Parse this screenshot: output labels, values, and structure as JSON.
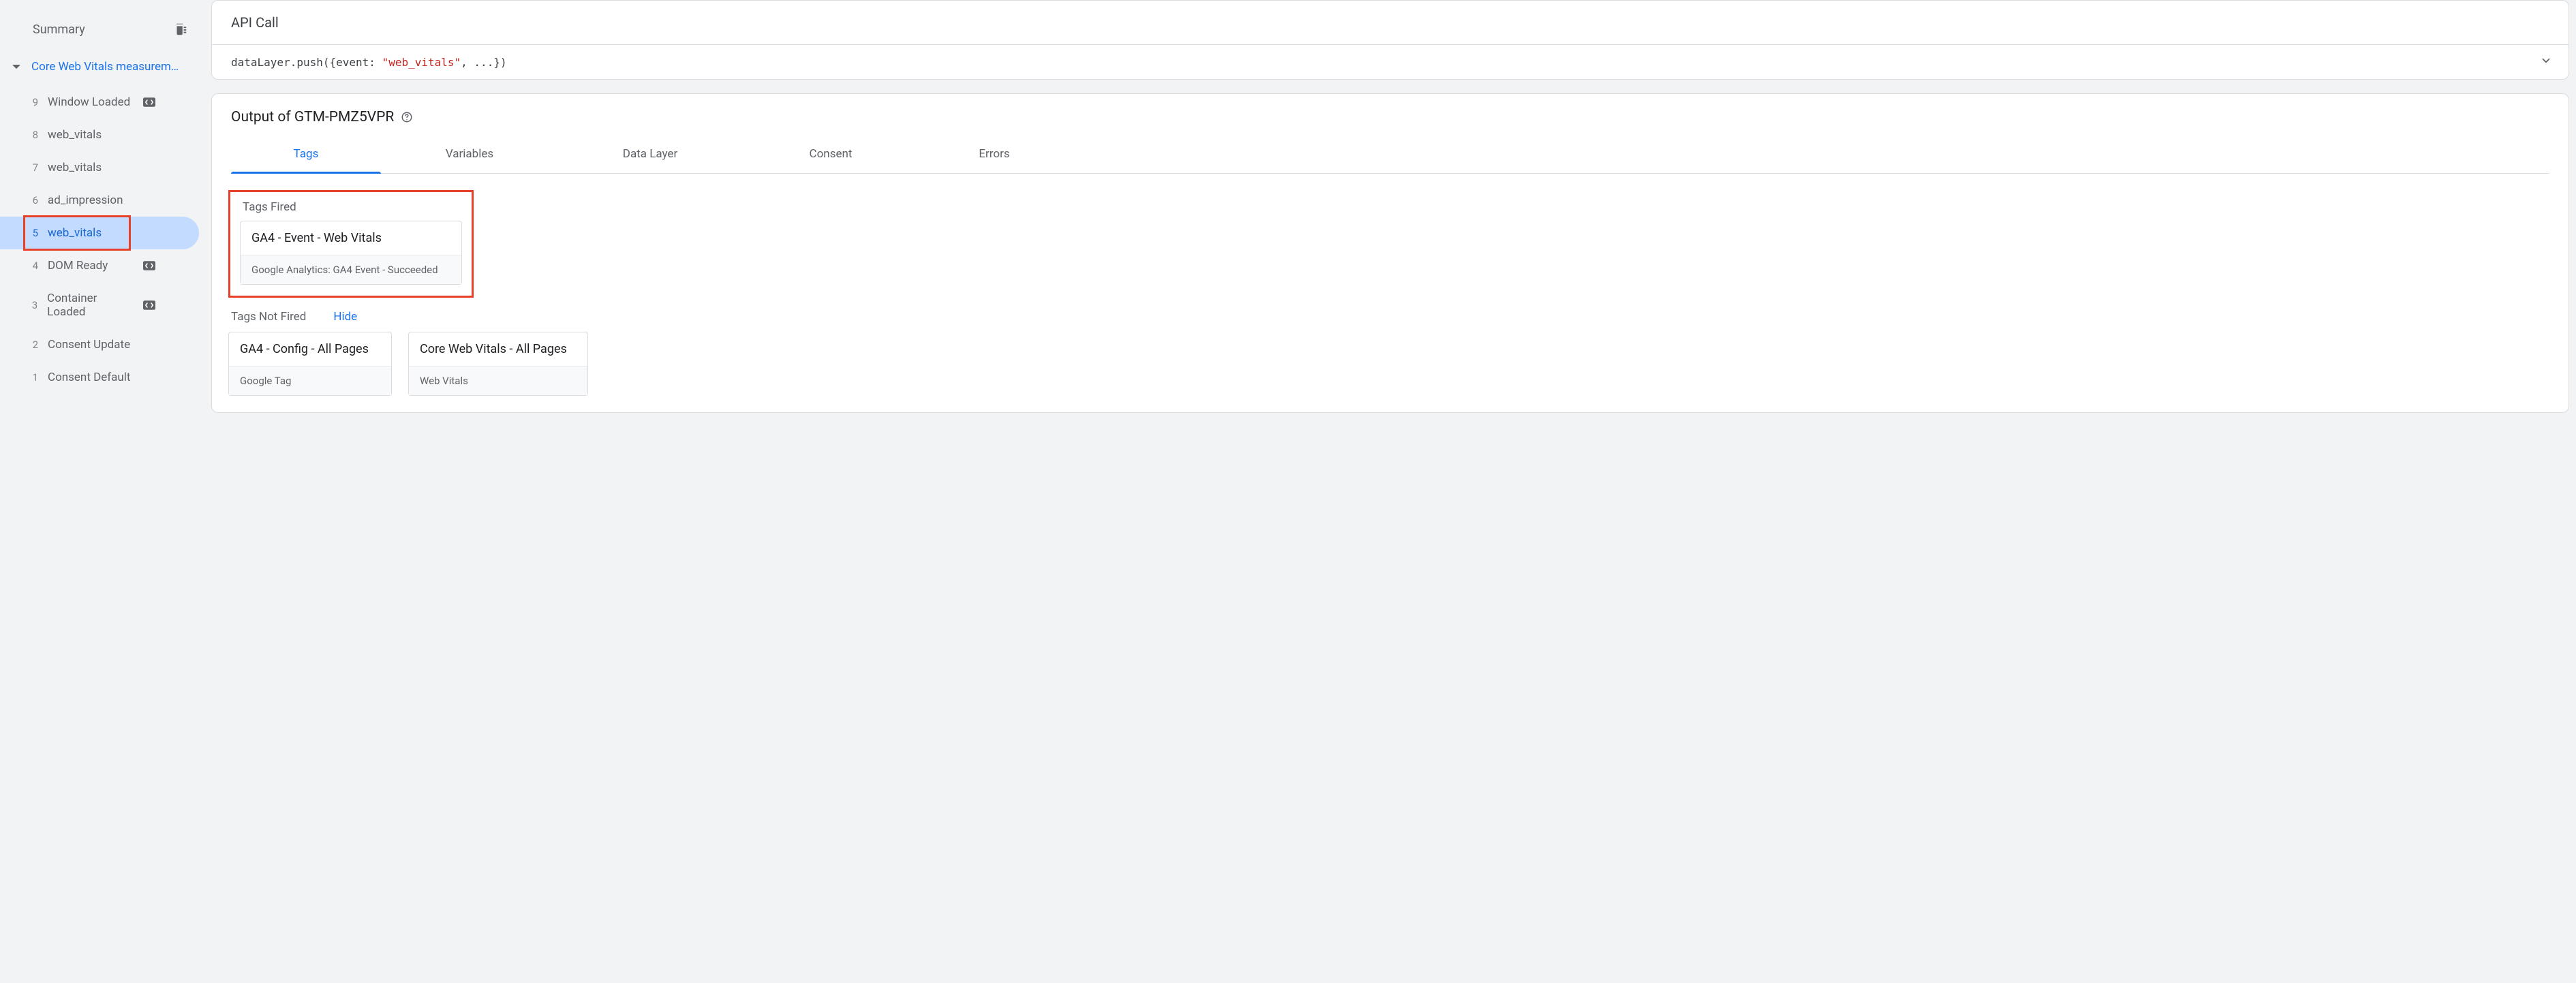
{
  "sidebar": {
    "summary_label": "Summary",
    "group_label": "Core Web Vitals measurem…",
    "events": [
      {
        "idx": "9",
        "label": "Window Loaded",
        "has_code_icon": true,
        "selected": false
      },
      {
        "idx": "8",
        "label": "web_vitals",
        "has_code_icon": false,
        "selected": false
      },
      {
        "idx": "7",
        "label": "web_vitals",
        "has_code_icon": false,
        "selected": false
      },
      {
        "idx": "6",
        "label": "ad_impression",
        "has_code_icon": false,
        "selected": false
      },
      {
        "idx": "5",
        "label": "web_vitals",
        "has_code_icon": false,
        "selected": true
      },
      {
        "idx": "4",
        "label": "DOM Ready",
        "has_code_icon": true,
        "selected": false
      },
      {
        "idx": "3",
        "label": "Container Loaded",
        "has_code_icon": true,
        "selected": false
      },
      {
        "idx": "2",
        "label": "Consent Update",
        "has_code_icon": false,
        "selected": false
      },
      {
        "idx": "1",
        "label": "Consent Default",
        "has_code_icon": false,
        "selected": false
      }
    ]
  },
  "api_call": {
    "title": "API Call",
    "code_prefix": "dataLayer.push({event: ",
    "code_string": "\"web_vitals\"",
    "code_suffix": ", ...})"
  },
  "output": {
    "title": "Output of GTM-PMZ5VPR",
    "tabs": {
      "tags": "Tags",
      "variables": "Variables",
      "data_layer": "Data Layer",
      "consent": "Consent",
      "errors": "Errors"
    },
    "fired_label": "Tags Fired",
    "fired": [
      {
        "title": "GA4 - Event - Web Vitals",
        "sub": "Google Analytics: GA4 Event - Succeeded"
      }
    ],
    "not_fired_label": "Tags Not Fired",
    "hide_label": "Hide",
    "not_fired": [
      {
        "title": "GA4 - Config - All Pages",
        "sub": "Google Tag"
      },
      {
        "title": "Core Web Vitals - All Pages",
        "sub": "Web Vitals"
      }
    ]
  }
}
